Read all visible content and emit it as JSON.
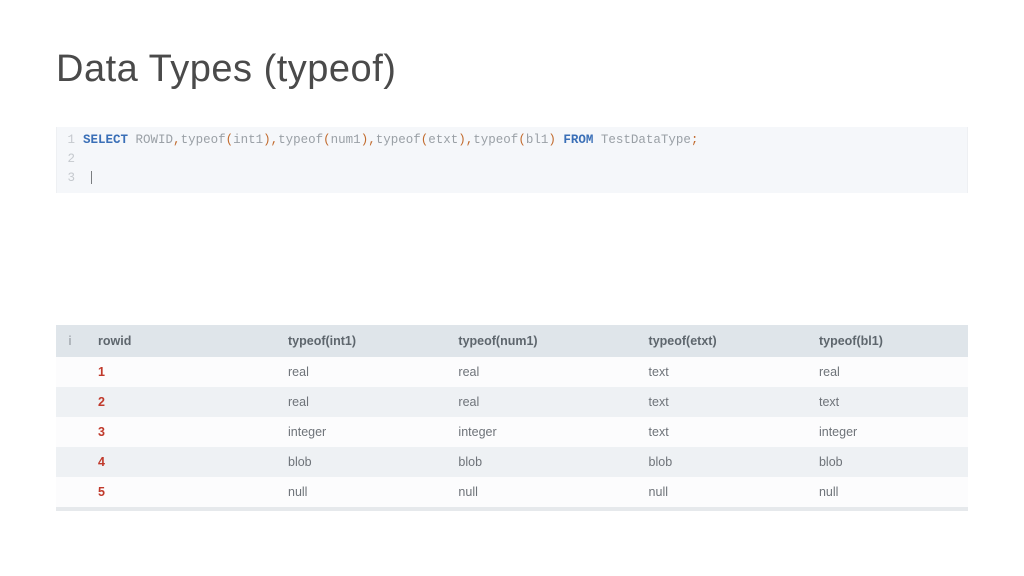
{
  "title": "Data Types (typeof)",
  "editor": {
    "line1_num": "1",
    "line2_num": "2",
    "line3_num": "3",
    "tokens": {
      "select": "SELECT",
      "rowid": "ROWID",
      "typeof1": "typeof",
      "arg1": "int1",
      "typeof2": "typeof",
      "arg2": "num1",
      "typeof3": "typeof",
      "arg3": "etxt",
      "typeof4": "typeof",
      "arg4": "bl1",
      "from": "FROM",
      "table": "TestDataType",
      "comma": ",",
      "lpar": "(",
      "rpar": ")",
      "semi": ";"
    }
  },
  "results": {
    "idx_header": "i",
    "headers": {
      "c0": "rowid",
      "c1": "typeof(int1)",
      "c2": "typeof(num1)",
      "c3": "typeof(etxt)",
      "c4": "typeof(bl1)"
    },
    "rows": {
      "r1": {
        "rowid": "1",
        "c1": "real",
        "c2": "real",
        "c3": "text",
        "c4": "real"
      },
      "r2": {
        "rowid": "2",
        "c1": "real",
        "c2": "real",
        "c3": "text",
        "c4": "text"
      },
      "r3": {
        "rowid": "3",
        "c1": "integer",
        "c2": "integer",
        "c3": "text",
        "c4": "integer"
      },
      "r4": {
        "rowid": "4",
        "c1": "blob",
        "c2": "blob",
        "c3": "blob",
        "c4": "blob"
      },
      "r5": {
        "rowid": "5",
        "c1": "null",
        "c2": "null",
        "c3": "null",
        "c4": "null"
      }
    }
  }
}
